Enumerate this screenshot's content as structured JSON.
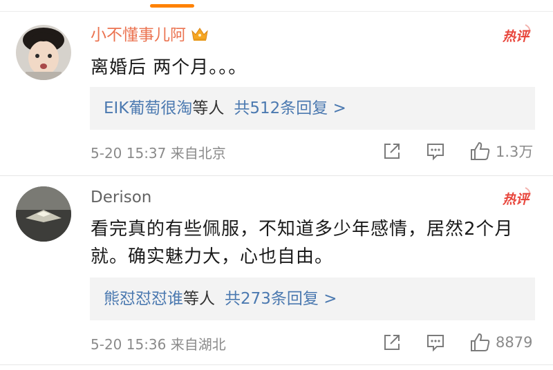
{
  "comments": [
    {
      "username": "小不懂事儿阿",
      "badge": "热评",
      "text": "离婚后 两个月。。。",
      "reply_names": "EIK葡萄很淘",
      "reply_mid": "等人",
      "reply_count": "共512条回复 >",
      "meta": "5-20 15:37 来自北京",
      "likes": "1.3万"
    },
    {
      "username": "Derison",
      "badge": "热评",
      "text": "看完真的有些佩服，不知道多少年感情，居然2个月就。确实魅力大，心也自由。",
      "reply_names": "熊怼怼怼谁",
      "reply_mid": "等人",
      "reply_count": "共273条回复 >",
      "meta": "5-20 15:36 来自湖北",
      "likes": "8879"
    }
  ],
  "colors": {
    "accent": "#ff8200",
    "vip_name": "#eb7350",
    "link": "#4b79b0",
    "hot_badge": "#e8463c",
    "meta": "#8a8a8a"
  },
  "icons": [
    "crown-icon",
    "share-icon",
    "comment-icon",
    "like-icon"
  ]
}
